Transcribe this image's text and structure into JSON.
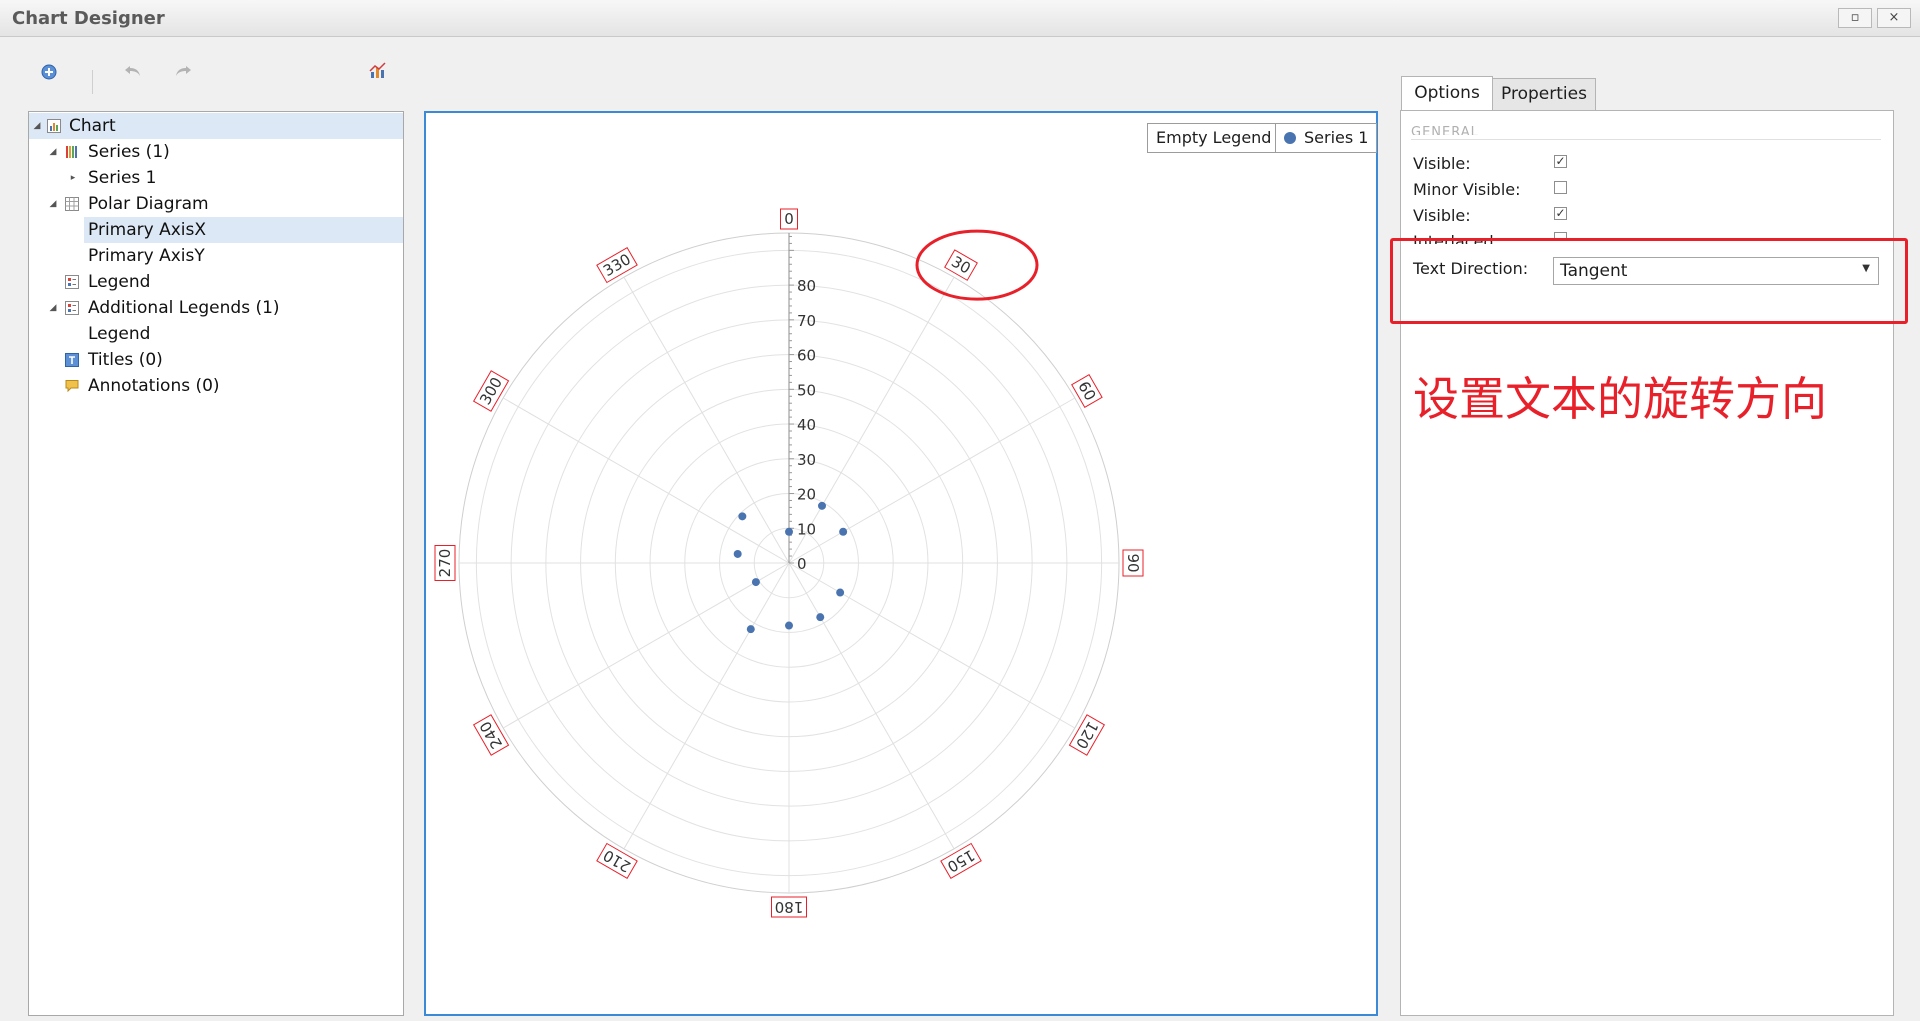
{
  "window": {
    "title": "Chart Designer",
    "maximize_glyph": "▫",
    "close_glyph": "×"
  },
  "toolbar": {
    "add_icon": "plus-circle-icon",
    "undo_icon": "undo-icon",
    "redo_icon": "redo-icon",
    "chart_wizard_icon": "chart-wizard-icon"
  },
  "tree": {
    "items": [
      {
        "label": "Chart",
        "expanded": true,
        "selected": true,
        "icon": "chart-icon"
      },
      {
        "label": "Series (1)",
        "expanded": true,
        "icon": "series-icon"
      },
      {
        "label": "Series 1",
        "expanded": false
      },
      {
        "label": "Polar Diagram",
        "expanded": true,
        "icon": "grid-icon"
      },
      {
        "label": "Primary AxisX",
        "selected": true
      },
      {
        "label": "Primary AxisY"
      },
      {
        "label": "Legend",
        "icon": "legend-icon"
      },
      {
        "label": "Additional Legends (1)",
        "expanded": true,
        "icon": "legend-icon"
      },
      {
        "label": "Legend"
      },
      {
        "label": "Titles (0)",
        "icon": "title-icon"
      },
      {
        "label": "Annotations (0)",
        "icon": "annotation-icon"
      }
    ]
  },
  "chart": {
    "legends": [
      {
        "label": "Empty Legend"
      },
      {
        "label": "Series 1"
      }
    ],
    "series_color": "#4a74b0",
    "label_border_color": "#e8202a"
  },
  "chart_data": {
    "type": "scatter",
    "coordinate_system": "polar",
    "angle_tick_labels": [
      "0",
      "30",
      "60",
      "90",
      "120",
      "150",
      "180",
      "210",
      "240",
      "270",
      "300",
      "330"
    ],
    "radial_tick_labels": [
      "0",
      "10",
      "20",
      "30",
      "40",
      "50",
      "60",
      "70",
      "80"
    ],
    "radial_range": [
      0,
      95
    ],
    "grid": true,
    "series": [
      {
        "name": "Series 1",
        "points": [
          {
            "angle": 0,
            "r": 9
          },
          {
            "angle": 30,
            "r": 19
          },
          {
            "angle": 60,
            "r": 18
          },
          {
            "angle": 120,
            "r": 17
          },
          {
            "angle": 150,
            "r": 18
          },
          {
            "angle": 180,
            "r": 18
          },
          {
            "angle": 210,
            "r": 22
          },
          {
            "angle": 240,
            "r": 11
          },
          {
            "angle": 280,
            "r": 15
          },
          {
            "angle": 315,
            "r": 19
          }
        ]
      }
    ],
    "legend_position": "top-right"
  },
  "tabs": [
    {
      "label": "Options",
      "active": true
    },
    {
      "label": "Properties",
      "active": false
    }
  ],
  "options": {
    "section_header": "GENERAL",
    "rows": [
      {
        "label": "Visible:",
        "checked": true
      },
      {
        "label": "Minor Visible:",
        "checked": false
      },
      {
        "label": "Visible:",
        "checked": true
      },
      {
        "label": "Interlaced:",
        "checked": false
      }
    ],
    "text_direction": {
      "label": "Text Direction:",
      "value": "Tangent"
    }
  },
  "annotation": {
    "text": "设置文本的旋转方向",
    "color": "#e8202a"
  }
}
